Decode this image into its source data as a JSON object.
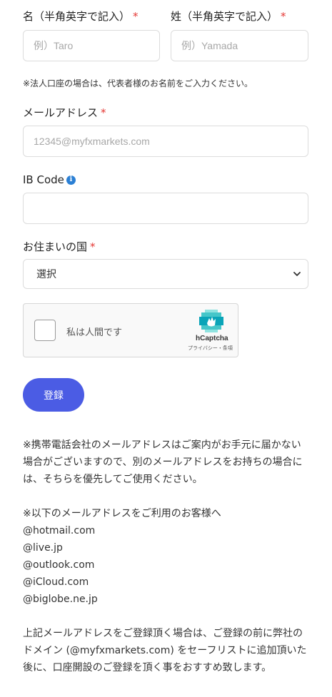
{
  "first_name": {
    "label": "名（半角英字で記入）",
    "required_mark": "*",
    "placeholder": "例）Taro"
  },
  "last_name": {
    "label": "姓（半角英字で記入）",
    "required_mark": "*",
    "placeholder": "例）Yamada"
  },
  "corporate_note": "※法人口座の場合は、代表者様のお名前をご入力ください。",
  "email": {
    "label": "メールアドレス",
    "required_mark": "*",
    "placeholder": "12345@myfxmarkets.com"
  },
  "ib_code": {
    "label": "IB Code",
    "info_icon": "i",
    "value": ""
  },
  "country": {
    "label": "お住まいの国",
    "required_mark": "*",
    "selected": "選択"
  },
  "captcha": {
    "checkbox_label": "私は人間です",
    "brand": "hCaptcha",
    "links": "プライバシー・条項"
  },
  "submit_label": "登録",
  "notes": {
    "mobile_warning": "※携帯電話会社のメールアドレスはご案内がお手元に届かない場合がございますので、別のメールアドレスをお持ちの場合には、そちらを優先してご使用ください。",
    "domains_intro": "※以下のメールアドレスをご利用のお客様へ",
    "domains": [
      "@hotmail.com",
      "@live.jp",
      "@outlook.com",
      "@iCloud.com",
      "@biglobe.ne.jp"
    ],
    "safelist_advice": "上記メールアドレスをご登録頂く場合は、ご登録の前に弊社のドメイン (@myfxmarkets.com) をセーフリストに追加頂いた後に、口座開設のご登録を頂く事をおすすめ致します。"
  },
  "colors": {
    "required": "#e53935",
    "button": "#4b5ce4",
    "info_icon": "#2a7fd4"
  }
}
